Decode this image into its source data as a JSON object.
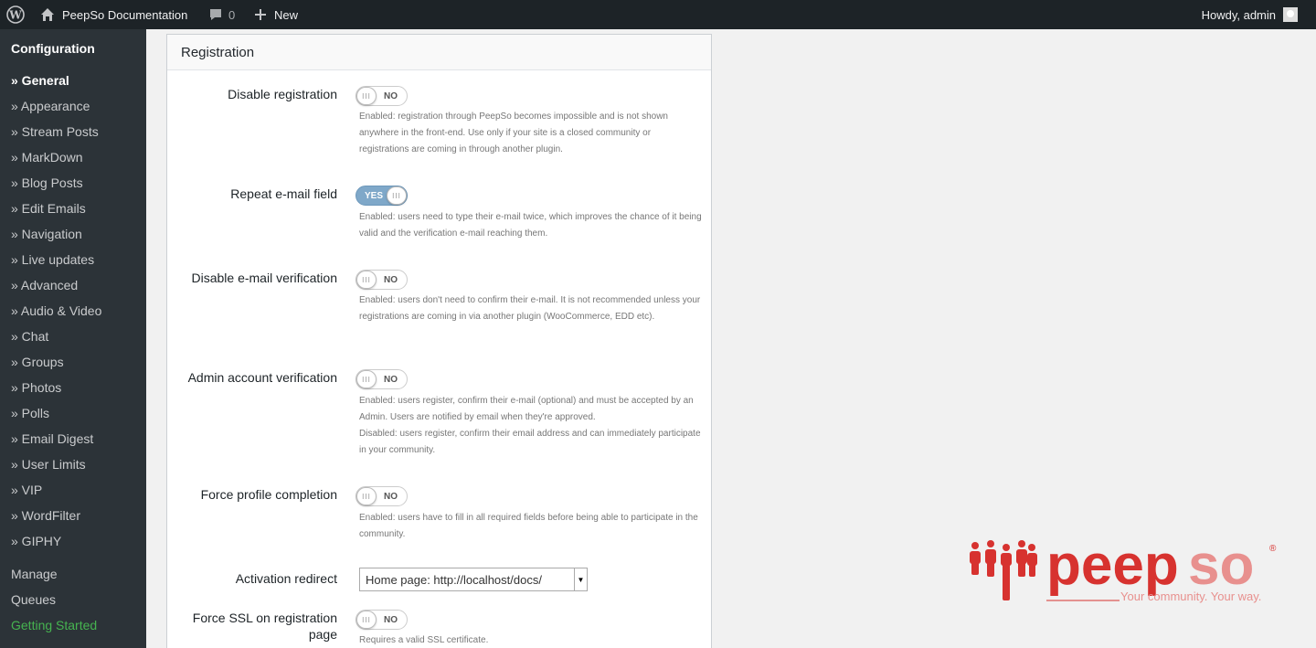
{
  "adminbar": {
    "site_name": "PeepSo Documentation",
    "comments_count": "0",
    "new_label": "New",
    "howdy": "Howdy, admin"
  },
  "sidebar": {
    "title": "Configuration",
    "items": [
      {
        "label": "» General",
        "active": true
      },
      {
        "label": "» Appearance"
      },
      {
        "label": "» Stream Posts"
      },
      {
        "label": "» MarkDown"
      },
      {
        "label": "» Blog Posts"
      },
      {
        "label": "» Edit Emails"
      },
      {
        "label": "» Navigation"
      },
      {
        "label": "» Live updates"
      },
      {
        "label": "» Advanced"
      },
      {
        "label": "» Audio & Video"
      },
      {
        "label": "» Chat"
      },
      {
        "label": "» Groups"
      },
      {
        "label": "» Photos"
      },
      {
        "label": "» Polls"
      },
      {
        "label": "» Email Digest"
      },
      {
        "label": "» User Limits"
      },
      {
        "label": "» VIP"
      },
      {
        "label": "» WordFilter"
      },
      {
        "label": "» GIPHY"
      }
    ],
    "manage": "Manage",
    "queues": "Queues",
    "getting_started": "Getting Started"
  },
  "panel": {
    "title": "Registration",
    "settings": [
      {
        "label": "Disable registration",
        "toggle": "NO",
        "desc": "Enabled: registration through PeepSo becomes impossible and is not shown anywhere in the front-end. Use only if your site is a closed community or registrations are coming in through another plugin."
      },
      {
        "label": "Repeat e-mail field",
        "toggle": "YES",
        "desc": "Enabled: users need to type their e-mail twice, which improves the chance of it being valid and the verification e-mail reaching them."
      },
      {
        "label": "Disable e-mail verification",
        "toggle": "NO",
        "desc": "Enabled: users don't need to confirm their e-mail. It is not recommended unless your registrations are coming in via another plugin (WooCommerce, EDD etc)."
      },
      {
        "label": "Admin account verification",
        "toggle": "NO",
        "desc": "Enabled: users register, confirm their e-mail (optional) and must be accepted by an Admin. Users are notified by email when they're approved.",
        "desc2": "Disabled: users register, confirm their email address and can immediately participate in your community."
      },
      {
        "label": "Force profile completion",
        "toggle": "NO",
        "desc": "Enabled: users have to fill in all required fields before being able to participate in the community."
      },
      {
        "label": "Activation redirect",
        "select": "Home page: http://localhost/docs/"
      },
      {
        "label": "Force SSL on registration page",
        "toggle": "NO",
        "desc": "Requires a valid SSL certificate."
      }
    ]
  },
  "logo": {
    "word_peep": "peep",
    "word_so": "so",
    "registered": "®",
    "tagline": "Your community. Your way."
  },
  "colors": {
    "accent_red": "#d7322f",
    "accent_pink": "#e8908e",
    "toggle_on": "#7fa8c9"
  }
}
